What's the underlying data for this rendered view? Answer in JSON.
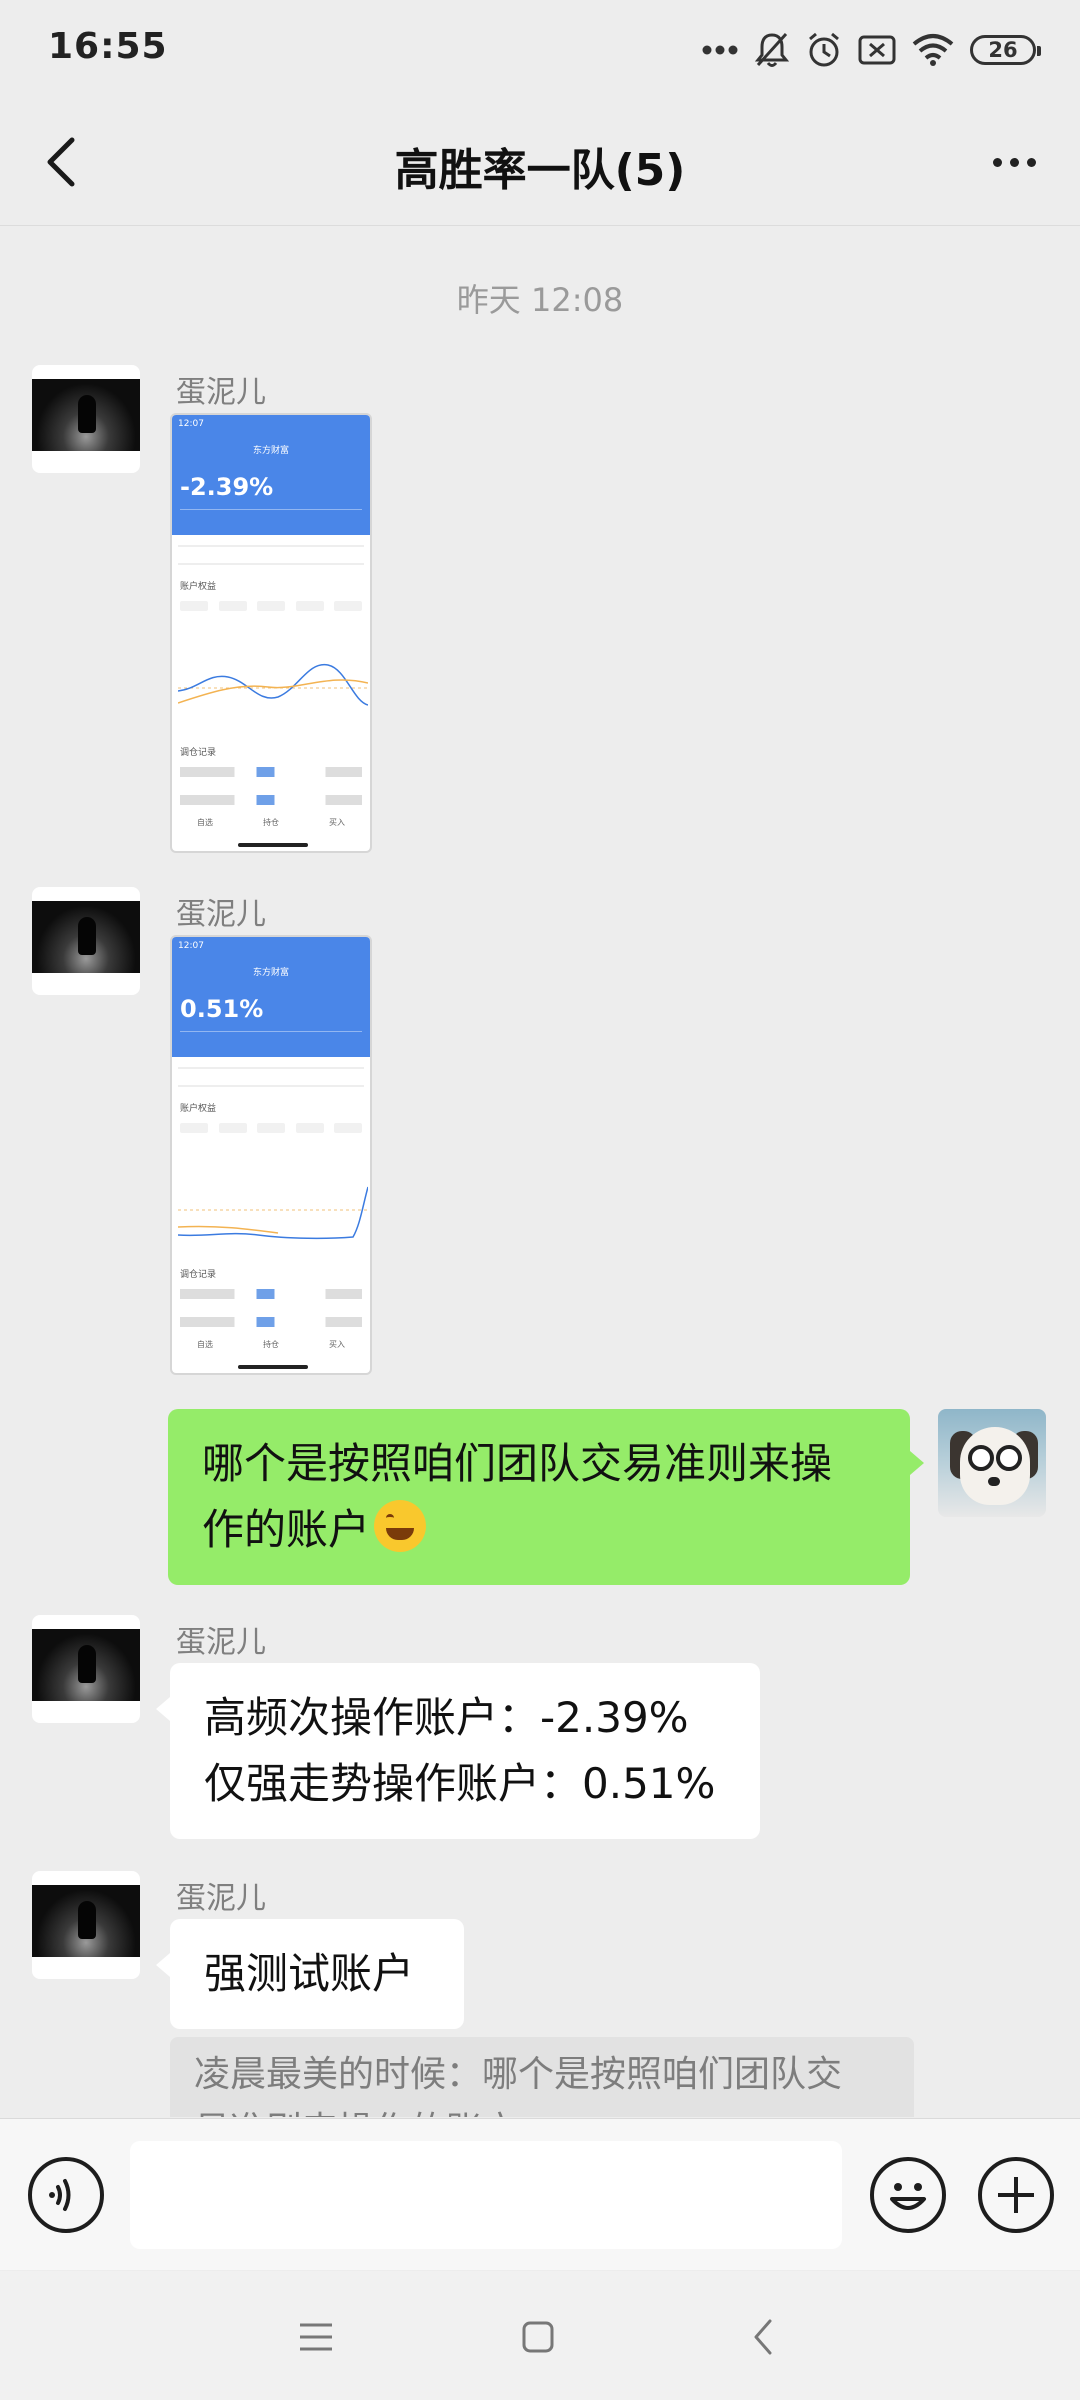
{
  "status_bar": {
    "time": "16:55",
    "battery": "26",
    "icons": [
      "more-dots-icon",
      "bell-muted-icon",
      "alarm-icon",
      "sim-disabled-icon",
      "wifi-icon",
      "battery-icon"
    ]
  },
  "header": {
    "title": "高胜率一队(5)",
    "back_icon": "chevron-left-icon",
    "more_icon": "more-horizontal-icon"
  },
  "chat": {
    "timestamp": "昨天 12:08",
    "messages": [
      {
        "type": "image",
        "sender": "蛋泥儿",
        "screenshot": {
          "time": "12:07",
          "name": "东方财富",
          "return": "-2.39%",
          "section_title": "账户权益",
          "records_title": "调仓记录",
          "tabs": [
            "自选",
            "持仓",
            "买入"
          ]
        }
      },
      {
        "type": "image",
        "sender": "蛋泥儿",
        "screenshot": {
          "time": "12:07",
          "name": "东方财富",
          "return": "0.51%",
          "section_title": "账户权益",
          "records_title": "调仓记录",
          "tabs": [
            "自选",
            "持仓",
            "买入"
          ]
        }
      },
      {
        "type": "text",
        "self": true,
        "lines": [
          "哪个是按照咱们团队交易准则来操",
          "作的账户"
        ],
        "emoji": "tears-of-joy-emoji"
      },
      {
        "type": "text",
        "sender": "蛋泥儿",
        "lines": [
          "高频次操作账户：-2.39%",
          "仅强走势操作账户：0.51%"
        ]
      },
      {
        "type": "text",
        "sender": "蛋泥儿",
        "lines": [
          "强测试账户"
        ]
      }
    ],
    "quote": {
      "lines": [
        "凌晨最美的时候：哪个是按照咱们团队交",
        "易准则来操作的账户"
      ]
    }
  },
  "input_bar": {
    "voice_icon": "voice-icon",
    "emoji_icon": "smiley-icon",
    "plus_icon": "plus-circle-icon"
  },
  "nav_bar": {
    "icons": [
      "menu-icon",
      "home-square-icon",
      "back-icon"
    ]
  }
}
